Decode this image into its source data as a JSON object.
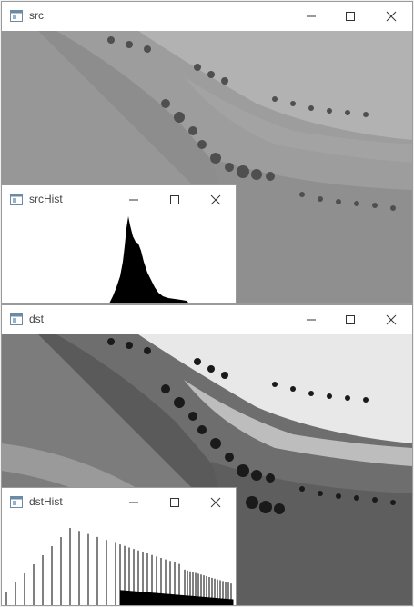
{
  "windows": {
    "src": {
      "title": "src"
    },
    "srcHist": {
      "title": "srcHist"
    },
    "dst": {
      "title": "dst"
    },
    "dstHist": {
      "title": "dstHist"
    }
  },
  "controls": {
    "minimize": "minimize-icon",
    "maximize": "maximize-icon",
    "close": "close-icon"
  },
  "colors": {
    "titlebar": "#ffffff",
    "border": "#9a9a9a",
    "histogram": "#000000"
  }
}
